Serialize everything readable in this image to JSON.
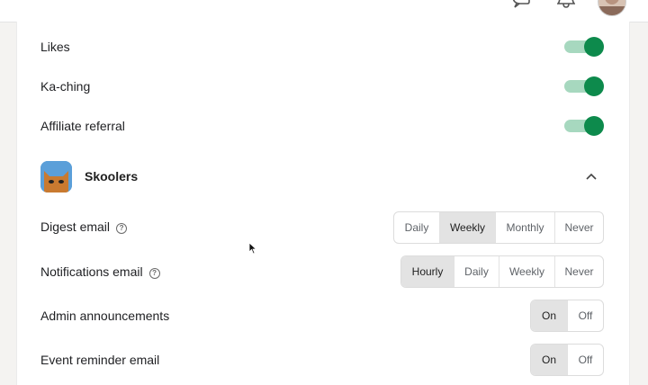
{
  "colors": {
    "toggle_on": "#0d8a4c",
    "toggle_track": "#a7d8bf",
    "segment_selected": "#e3e3e3"
  },
  "header": {
    "icons": [
      "chat-icon",
      "bell-icon",
      "user-avatar"
    ]
  },
  "toggles": [
    {
      "label": "Likes",
      "on": true
    },
    {
      "label": "Ka-ching",
      "on": true
    },
    {
      "label": "Affiliate referral",
      "on": true
    }
  ],
  "group": {
    "name": "Skoolers",
    "expanded": true
  },
  "settings": {
    "digest_email": {
      "label": "Digest email",
      "options": [
        "Daily",
        "Weekly",
        "Monthly",
        "Never"
      ],
      "selected": "Weekly"
    },
    "notifications_email": {
      "label": "Notifications email",
      "options": [
        "Hourly",
        "Daily",
        "Weekly",
        "Never"
      ],
      "selected": "Hourly"
    },
    "admin_announcements": {
      "label": "Admin announcements",
      "options": [
        "On",
        "Off"
      ],
      "selected": "On"
    },
    "event_reminder_email": {
      "label": "Event reminder email",
      "options": [
        "On",
        "Off"
      ],
      "selected": "On"
    }
  }
}
